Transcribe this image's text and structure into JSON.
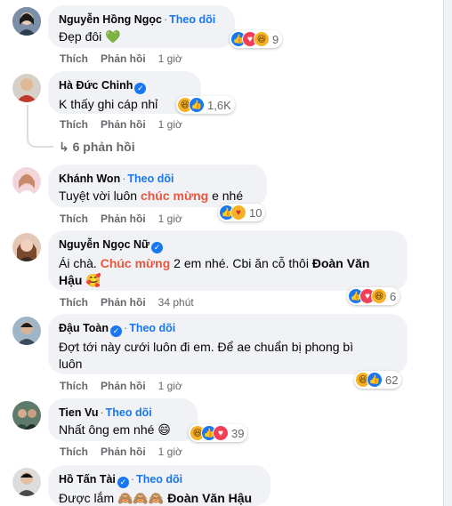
{
  "labels": {
    "like": "Thích",
    "reply": "Phản hồi",
    "follow": "Theo dõi",
    "dot": "·"
  },
  "comments": [
    {
      "name": "Nguyễn Hồng Ngọc",
      "verified": false,
      "follow": true,
      "text": "Đẹp đôi 💚",
      "time": "1 giờ",
      "reactions": [
        "like",
        "love",
        "haha"
      ],
      "count": "9",
      "avatar_color": "#6b7f99"
    },
    {
      "name": "Hà Đức Chinh",
      "verified": true,
      "follow": false,
      "text": "K thấy ghi cáp nhỉ",
      "time": "1 giờ",
      "reactions": [
        "haha",
        "like"
      ],
      "count": "1,6K",
      "replies": "6 phản hồi",
      "avatar_color": "#c0392b"
    },
    {
      "name": "Khánh Won",
      "verified": false,
      "follow": true,
      "text_parts": [
        "Tuyệt vời luôn ",
        "chúc mừng",
        " e nhé"
      ],
      "time": "1 giờ",
      "reactions": [
        "like",
        "care"
      ],
      "count": "10",
      "avatar_color": "#e7b9c3"
    },
    {
      "name": "Nguyễn Ngọc Nữ",
      "verified": true,
      "follow": false,
      "text_parts": [
        "Ái chà. ",
        "Chúc mừng",
        " 2 em nhé. Cbi ăn cỗ thôi ",
        "Đoàn Văn",
        "Hậu",
        " 🥰"
      ],
      "time": "34 phút",
      "reactions": [
        "like",
        "love",
        "haha"
      ],
      "count": "6",
      "avatar_color": "#8e5a3c"
    },
    {
      "name": "Đậu Toàn",
      "verified": true,
      "follow": true,
      "text_lines": [
        "Đợt tới này cưới luôn đi em. Để ae chuẩn bị phong bì",
        "luôn"
      ],
      "time": "1 giờ",
      "reactions": [
        "haha",
        "like"
      ],
      "count": "62",
      "avatar_color": "#3d4b5c"
    },
    {
      "name": "Tien Vu",
      "verified": false,
      "follow": true,
      "text": "Nhất ông em nhé 😄",
      "time": "1 giờ",
      "reactions": [
        "haha",
        "like",
        "love"
      ],
      "count": "39",
      "avatar_color": "#2e4a3a"
    },
    {
      "name": "Hồ Tấn Tài",
      "verified": true,
      "follow": true,
      "text_parts": [
        "Được lắm 🙈🙈🙈 ",
        "Đoàn Văn Hậu"
      ],
      "avatar_color": "#4a4a4a"
    }
  ]
}
